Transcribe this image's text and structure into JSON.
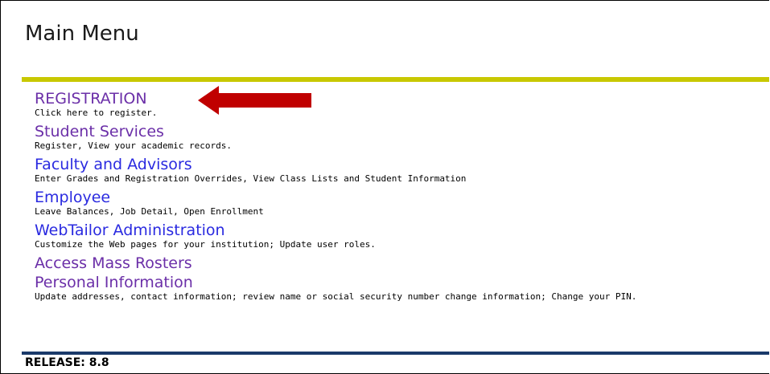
{
  "page": {
    "title": "Main Menu",
    "release": "RELEASE: 8.8"
  },
  "colors": {
    "accent_bar": "#c8c800",
    "bottom_bar": "#1a3a6a",
    "visited_link": "#6b2fa8",
    "unvisited_link": "#2a2ae0",
    "annotation_arrow": "#c00000"
  },
  "menu": {
    "items": [
      {
        "label": "REGISTRATION",
        "description": "Click here to register.",
        "state": "visited"
      },
      {
        "label": "Student Services",
        "description": "Register, View your academic records.",
        "state": "visited"
      },
      {
        "label": "Faculty and Advisors",
        "description": "Enter Grades and Registration Overrides, View Class Lists and Student Information",
        "state": "unvisited"
      },
      {
        "label": "Employee",
        "description": "Leave Balances, Job Detail, Open Enrollment",
        "state": "unvisited"
      },
      {
        "label": "WebTailor Administration",
        "description": "Customize the Web pages for your institution; Update user roles.",
        "state": "unvisited"
      },
      {
        "label": "Access Mass Rosters",
        "description": "",
        "state": "visited"
      },
      {
        "label": "Personal Information",
        "description": "Update addresses, contact information; review name or social security number change information; Change your PIN.",
        "state": "visited"
      }
    ]
  },
  "annotation": {
    "icon": "left-arrow-icon"
  }
}
